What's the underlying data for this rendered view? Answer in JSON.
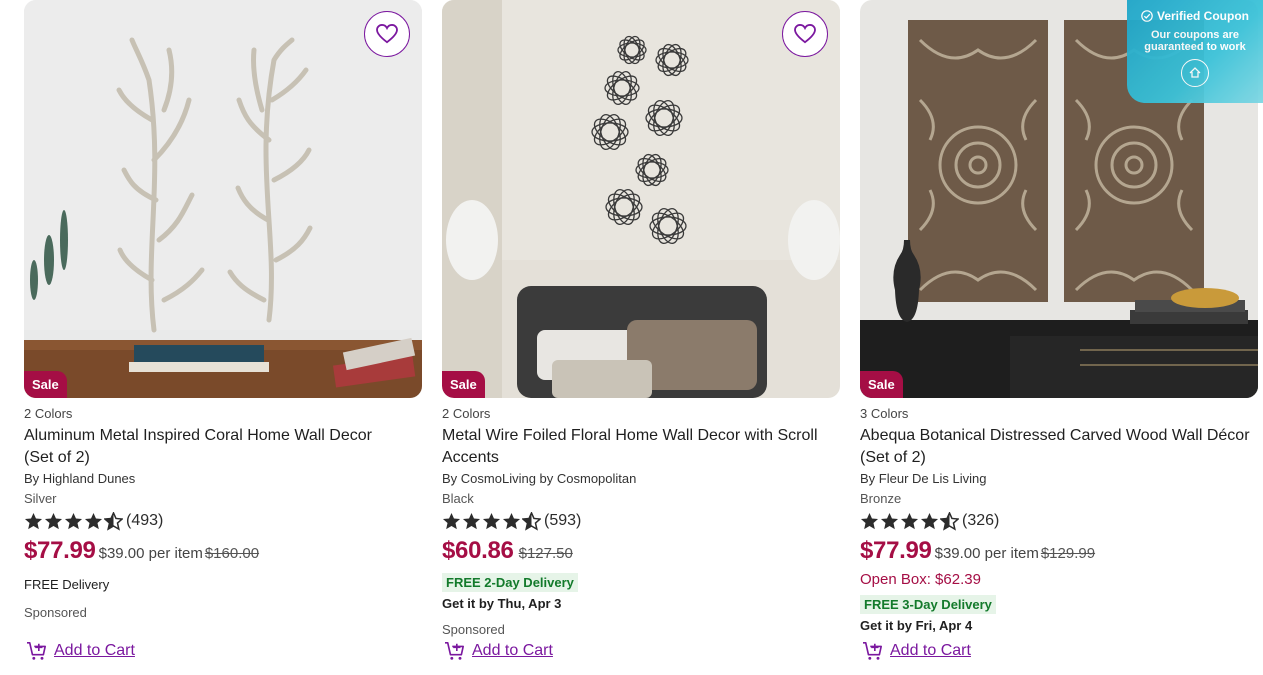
{
  "products": [
    {
      "colors": "2 Colors",
      "title_line1": "Aluminum Metal Inspired Coral Home Wall Decor",
      "title_line2": "(Set of 2)",
      "brand": "By Highland Dunes",
      "variant": "Silver",
      "rating_count": "(493)",
      "rating": 4.5,
      "price": "$77.99",
      "unit_price": "$39.00 per item",
      "was_price": "$160.00",
      "open_box": "",
      "delivery": "FREE Delivery",
      "delivery_by": "",
      "sponsored": "Sponsored",
      "add_to_cart": "Add to Cart",
      "badge": "Sale"
    },
    {
      "colors": "2 Colors",
      "title_line1": "Metal Wire Foiled Floral Home Wall Decor with Scroll",
      "title_line2": "Accents",
      "brand": "By CosmoLiving by Cosmopolitan",
      "variant": "Black",
      "rating_count": "(593)",
      "rating": 4.5,
      "price": "$60.86",
      "unit_price": "",
      "was_price": "$127.50",
      "open_box": "",
      "delivery": "FREE 2-Day Delivery",
      "delivery_by": "Get it by Thu, Apr 3",
      "sponsored": "Sponsored",
      "add_to_cart": "Add to Cart",
      "badge": "Sale"
    },
    {
      "colors": "3 Colors",
      "title_line1": "Abequa Botanical Distressed Carved Wood Wall Décor",
      "title_line2": "(Set of 2)",
      "brand": "By Fleur De Lis Living",
      "variant": "Bronze",
      "rating_count": "(326)",
      "rating": 4.5,
      "price": "$77.99",
      "unit_price": "$39.00 per item",
      "was_price": "$129.99",
      "open_box": "Open Box: $62.39",
      "delivery": "FREE 3-Day Delivery",
      "delivery_by": "Get it by Fri, Apr 4",
      "sponsored": "",
      "add_to_cart": "Add to Cart",
      "badge": "Sale"
    }
  ],
  "coupon": {
    "title": "Verified Coupon",
    "subtitle": "Our coupons are guaranteed to work"
  },
  "colors": {
    "sale": "#a50e45",
    "brand_purple": "#7b189f",
    "green": "#137a2b"
  },
  "icons": [
    "heart-icon",
    "star-icon",
    "half-star-icon",
    "cart-plus-icon",
    "check-badge-icon",
    "coupon-logo-icon"
  ]
}
